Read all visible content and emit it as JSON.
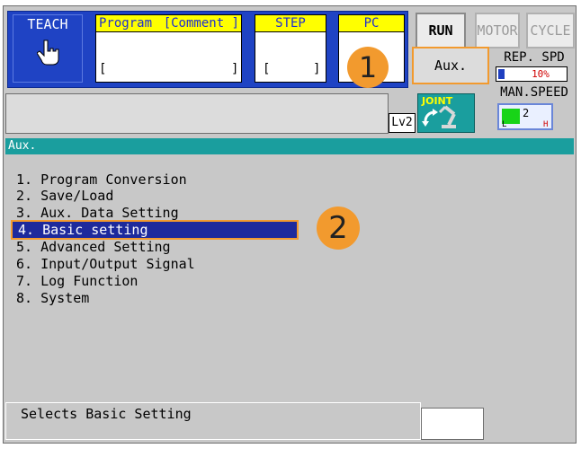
{
  "header": {
    "mode": "TEACH",
    "program_label": "Program",
    "comment_label": "[Comment ]",
    "program_value_left": "[",
    "program_value_right": "]",
    "step_label": "STEP",
    "step_value_left": "[",
    "step_value_right": "]",
    "pc_label": "PC"
  },
  "status_buttons": {
    "run": "RUN",
    "motor": "MOTOR",
    "cycle": "CYCLE",
    "aux": "Aux."
  },
  "speed": {
    "rep_label": "REP. SPD",
    "rep_value_text": "10%",
    "rep_value_percent": 10,
    "man_label": "MAN.SPEED",
    "man_value": "2",
    "man_low": "L",
    "man_high": "H"
  },
  "indicators": {
    "level": "Lv2",
    "coordinate": "JOINT"
  },
  "annotations": {
    "marker_1": "1",
    "marker_2": "2"
  },
  "window": {
    "title": "Aux.",
    "menu": [
      "1. Program Conversion",
      "2. Save/Load",
      "3. Aux. Data Setting",
      "4. Basic setting",
      "5. Advanced Setting",
      "6. Input/Output Signal",
      "7. Log Function",
      "8. System"
    ],
    "selected_index": 3
  },
  "status": {
    "message": "Selects Basic Setting"
  },
  "colors": {
    "panel_blue": "#1f43c4",
    "header_yellow": "#ffff00",
    "title_teal": "#1a9e9e",
    "selection_blue": "#1e2a9c",
    "highlight_orange": "#f29a2e"
  }
}
